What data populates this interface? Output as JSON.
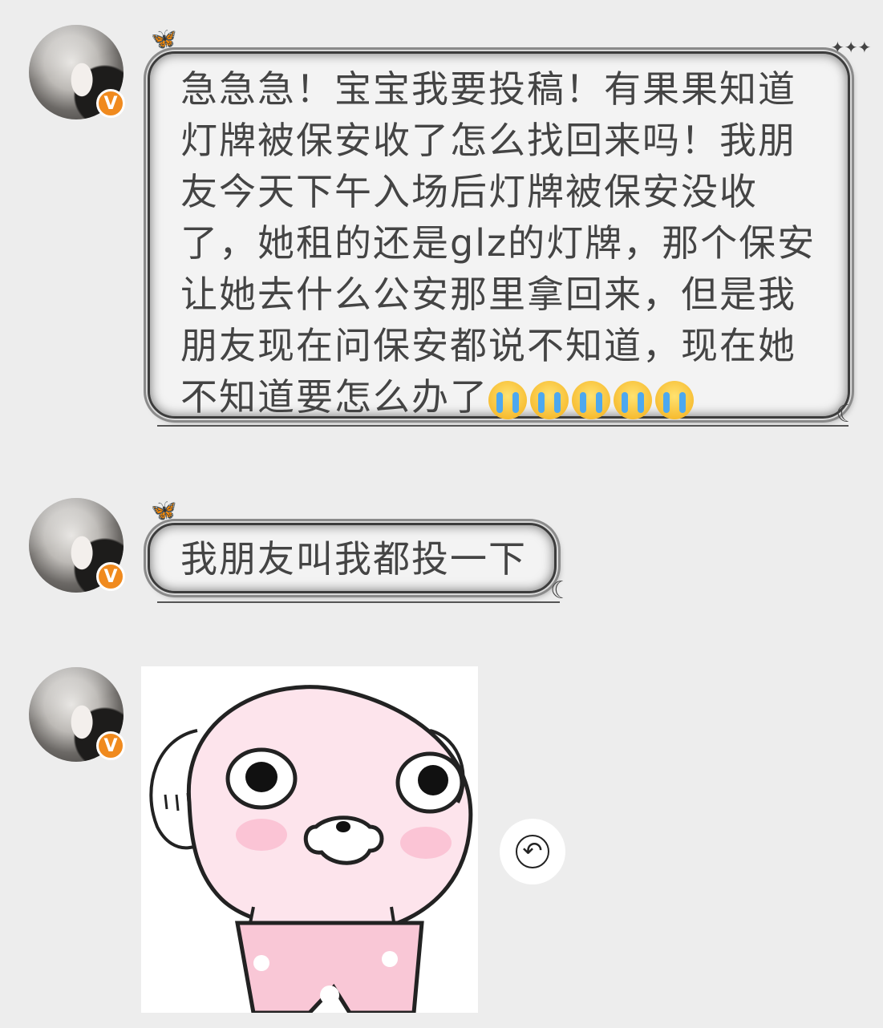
{
  "messages": [
    {
      "type": "text",
      "lines": [
        "急急急！宝宝我要投稿！有果果知道",
        "灯牌被保安收了怎么找回来吗！我朋",
        "友今天下午入场后灯牌被保安没收",
        "了，她租的还是glz的灯牌，那个保安",
        "让她去什么公安那里拿回来，但是我",
        "朋友现在问保安都说不知道，现在她",
        "不知道要怎么办了"
      ],
      "emojis": [
        "loudly-crying-face",
        "loudly-crying-face",
        "loudly-crying-face",
        "loudly-crying-face",
        "loudly-crying-face"
      ]
    },
    {
      "type": "text",
      "lines": [
        "我朋友叫我都投一下"
      ]
    },
    {
      "type": "sticker",
      "sticker_name": "pink-blob-sticker"
    }
  ],
  "avatar_badge": "V",
  "reply_icon": "↶",
  "colors": {
    "background": "#ededed",
    "badge": "#f08a1e",
    "bubble": "#f3f3f3",
    "text": "#444444"
  }
}
